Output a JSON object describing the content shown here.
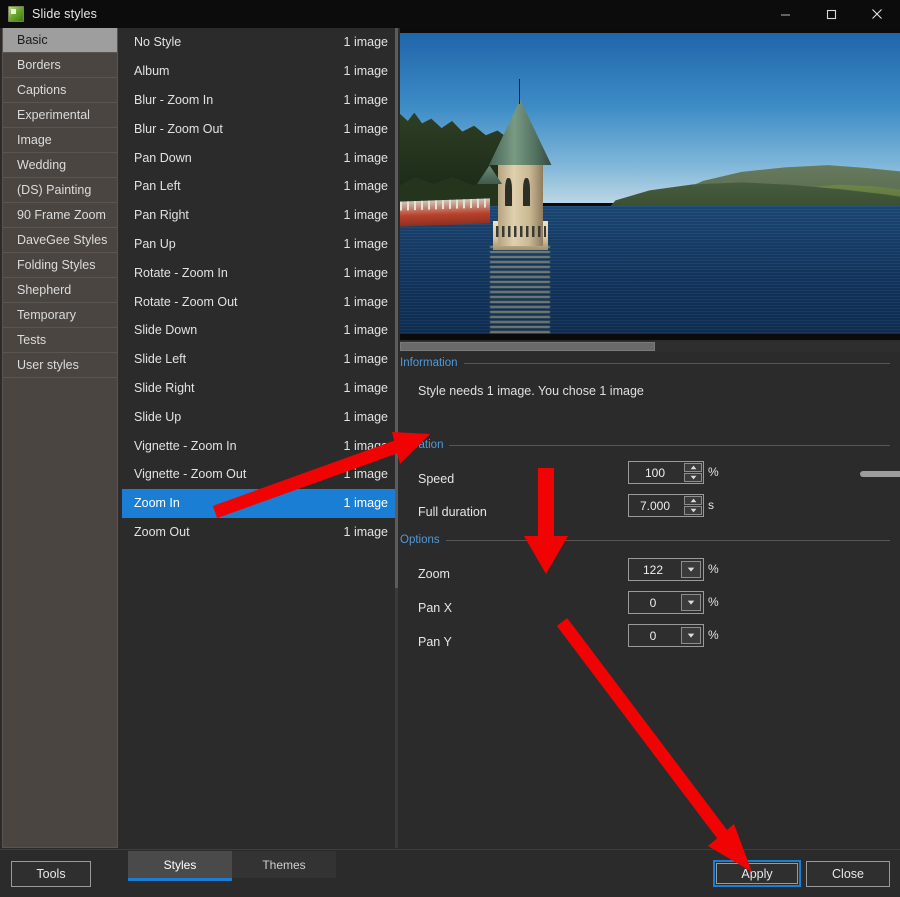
{
  "window": {
    "title": "Slide styles",
    "icon": "app-icon",
    "controls": {
      "minimize": "minimize-icon",
      "maximize": "maximize-icon",
      "close": "close-icon"
    }
  },
  "sidebar": {
    "selected": "Basic",
    "items": [
      {
        "label": "Basic"
      },
      {
        "label": "Borders"
      },
      {
        "label": "Captions"
      },
      {
        "label": "Experimental"
      },
      {
        "label": "Image"
      },
      {
        "label": "Wedding"
      },
      {
        "label": "(DS) Painting"
      },
      {
        "label": "90 Frame Zoom"
      },
      {
        "label": "DaveGee Styles"
      },
      {
        "label": "Folding Styles"
      },
      {
        "label": "Shepherd"
      },
      {
        "label": "Temporary"
      },
      {
        "label": "Tests"
      },
      {
        "label": "User styles"
      }
    ]
  },
  "style_list": {
    "selected": "Zoom In",
    "rows": [
      {
        "name": "No Style",
        "count": "1 image"
      },
      {
        "name": "Album",
        "count": "1 image"
      },
      {
        "name": "Blur - Zoom In",
        "count": "1 image"
      },
      {
        "name": "Blur - Zoom Out",
        "count": "1 image"
      },
      {
        "name": "Pan Down",
        "count": "1 image"
      },
      {
        "name": "Pan Left",
        "count": "1 image"
      },
      {
        "name": "Pan Right",
        "count": "1 image"
      },
      {
        "name": "Pan Up",
        "count": "1 image"
      },
      {
        "name": "Rotate - Zoom In",
        "count": "1 image"
      },
      {
        "name": "Rotate - Zoom Out",
        "count": "1 image"
      },
      {
        "name": "Slide Down",
        "count": "1 image"
      },
      {
        "name": "Slide Left",
        "count": "1 image"
      },
      {
        "name": "Slide Right",
        "count": "1 image"
      },
      {
        "name": "Slide Up",
        "count": "1 image"
      },
      {
        "name": "Vignette - Zoom In",
        "count": "1 image"
      },
      {
        "name": "Vignette - Zoom Out",
        "count": "1 image"
      },
      {
        "name": "Zoom In",
        "count": "1 image"
      },
      {
        "name": "Zoom Out",
        "count": "1 image"
      }
    ]
  },
  "preview": {
    "alt": "Reservoir valve tower on a lake with wooded hills",
    "scrollbar": "horizontal-scrollbar"
  },
  "information": {
    "title": "Information",
    "text": "Style needs 1 image. You chose 1 image"
  },
  "duration": {
    "title": "Duration",
    "speed": {
      "label": "Speed",
      "value": "100",
      "unit": "%",
      "slider_percent": 47
    },
    "full_duration": {
      "label": "Full duration",
      "value": "7.000",
      "unit": "s"
    }
  },
  "options": {
    "title": "Options",
    "zoom": {
      "label": "Zoom",
      "value": "122",
      "unit": "%"
    },
    "pan_x": {
      "label": "Pan X",
      "value": "0",
      "unit": "%"
    },
    "pan_y": {
      "label": "Pan Y",
      "value": "0",
      "unit": "%"
    }
  },
  "bottom": {
    "tools": "Tools",
    "tabs": [
      {
        "label": "Styles",
        "active": true
      },
      {
        "label": "Themes",
        "active": false
      }
    ],
    "apply": "Apply",
    "close": "Close"
  },
  "annotations": {
    "arrow_color": "#f10303",
    "arrows": [
      {
        "name": "arrow-to-speed",
        "from": [
          215,
          512
        ],
        "to": [
          424,
          437
        ]
      },
      {
        "name": "arrow-to-pan-fields",
        "from": [
          546,
          468
        ],
        "to": [
          546,
          570
        ]
      },
      {
        "name": "arrow-to-apply",
        "from": [
          562,
          622
        ],
        "to": [
          748,
          866
        ]
      }
    ]
  },
  "colors": {
    "accent": "#1a7fd4",
    "group_title": "#4f9ad8",
    "selection": "#1a7fd4",
    "sidebar_selected": "#9e9e9e",
    "background": "#2b2b2b",
    "titlebar": "#0c0c0c"
  }
}
